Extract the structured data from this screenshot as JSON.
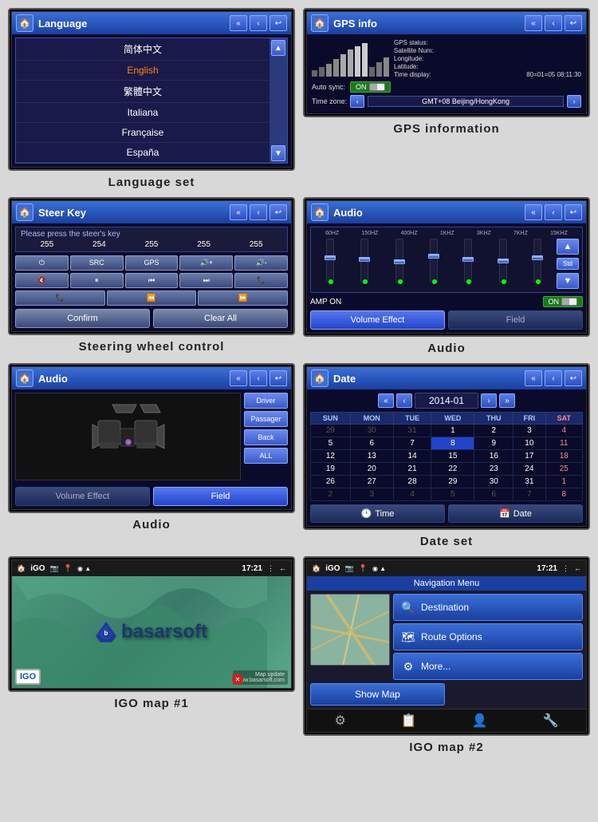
{
  "screens": [
    {
      "id": "language",
      "title": "Language",
      "caption": "Language  set",
      "items": [
        "简体中文",
        "English",
        "繁體中文",
        "Italiana",
        "Française",
        "España"
      ]
    },
    {
      "id": "gps",
      "title": "GPS info",
      "caption": "GPS information",
      "status_label": "GPS status:",
      "satellite_label": "Satellite Num:",
      "longitude_label": "Longitude:",
      "latitude_label": "Latitude:",
      "time_label": "Time display:",
      "time_value": "80=01=05 08:11:30",
      "auto_sync_label": "Auto sync:",
      "auto_sync_value": "ON",
      "time_zone_label": "Time zone:",
      "time_zone_value": "GMT+08 Beijing/HongKong"
    },
    {
      "id": "steer",
      "title": "Steer Key",
      "caption": "Steering wheel control",
      "prompt": "Please press the steer's key",
      "nums": [
        "255",
        "254",
        "255",
        "255",
        "255"
      ],
      "row1": [
        "⏻",
        "SRC",
        "GPS",
        "🔇+",
        "🔇-"
      ],
      "row2": [
        "🔇",
        "⏸",
        "⏮",
        "⏭",
        "📞"
      ],
      "row3": [
        "📞",
        "⏪",
        "⏩"
      ],
      "confirm": "Confirm",
      "clear_all": "Clear All"
    },
    {
      "id": "audio_eq",
      "title": "Audio",
      "caption": "Audio",
      "eq_labels": [
        "60HZ",
        "150HZ",
        "400HZ",
        "1KHZ",
        "3KHZ",
        "7KHZ",
        "15KHZ"
      ],
      "amp_label": "AMP ON",
      "amp_value": "ON",
      "btn1": "Volume Effect",
      "btn2": "Field"
    },
    {
      "id": "audio_seats",
      "title": "Audio",
      "caption": "Audio",
      "seat_btns": [
        "Driver",
        "Passager",
        "Back",
        "ALL"
      ],
      "btn1": "Volume Effect",
      "btn2": "Field"
    },
    {
      "id": "date",
      "title": "Date",
      "caption": "Date  set",
      "month": "2014-01",
      "days_header": [
        "SUN",
        "MON",
        "TUE",
        "WED",
        "THU",
        "FRI",
        "SAT"
      ],
      "weeks": [
        [
          "29",
          "30",
          "31",
          "",
          "2",
          "3",
          "4"
        ],
        [
          "5",
          "6",
          "7",
          "8",
          "9",
          "10",
          "11"
        ],
        [
          "12",
          "13",
          "14",
          "15",
          "16",
          "17",
          "18"
        ],
        [
          "19",
          "20",
          "21",
          "22",
          "23",
          "24",
          "25"
        ],
        [
          "26",
          "27",
          "28",
          "29",
          "30",
          "31",
          "1"
        ],
        [
          "2",
          "3",
          "4",
          "5",
          "6",
          "7",
          "8"
        ]
      ],
      "today_cell": [
        1,
        3
      ],
      "btn_time": "Time",
      "btn_date": "Date"
    },
    {
      "id": "igo1",
      "title": "iGO",
      "caption": "IGO map #1",
      "brand": "basarsoft",
      "logo_text": "IGO",
      "status_icons": [
        "🏠",
        "iGO",
        "📷",
        "📍",
        "◉",
        "▲",
        "17:21",
        "⋮",
        "←"
      ],
      "map_update": "Map update\nwww.basarsoft.com"
    },
    {
      "id": "igo2",
      "title": "iGO",
      "caption": "IGO map #2",
      "menu_title": "Navigation Menu",
      "menu_items": [
        {
          "icon": "🔍",
          "label": "Destination"
        },
        {
          "icon": "🗺",
          "label": "Route Options"
        },
        {
          "icon": "🗿",
          "label": "More..."
        }
      ],
      "show_map": "Show Map",
      "status_icons": [
        "🏠",
        "iGO",
        "📷",
        "📍",
        "◉",
        "▲",
        "17:21",
        "⋮",
        "←"
      ],
      "bottom_icons": [
        "⚙",
        "📋",
        "👤",
        "🔧"
      ]
    }
  ],
  "nav_btn_prev_prev": "«",
  "nav_btn_prev": "‹",
  "nav_btn_next": "›",
  "nav_btn_next_next": "»",
  "nav_btn_back": "↩"
}
